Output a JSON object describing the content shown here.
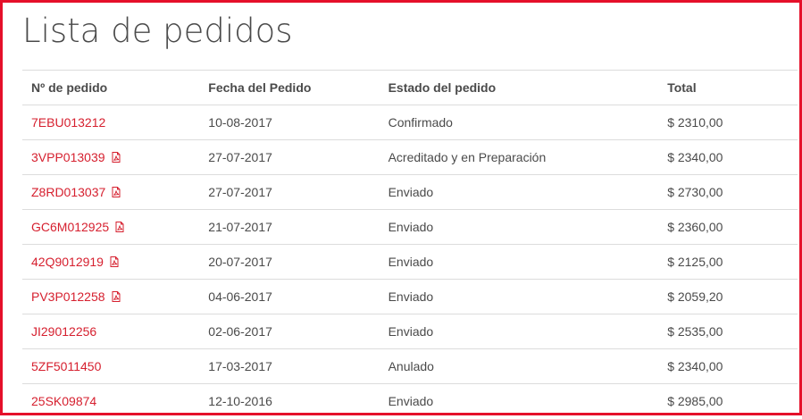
{
  "page": {
    "title": "Lista de pedidos"
  },
  "table": {
    "headers": [
      "Nº de pedido",
      "Fecha del Pedido",
      "Estado del pedido",
      "Total"
    ],
    "rows": [
      {
        "order": "7EBU013212",
        "date": "10-08-2017",
        "status": "Confirmado",
        "total": "$ 2310,00",
        "pdf": false
      },
      {
        "order": "3VPP013039",
        "date": "27-07-2017",
        "status": "Acreditado y en Preparación",
        "total": "$ 2340,00",
        "pdf": true
      },
      {
        "order": "Z8RD013037",
        "date": "27-07-2017",
        "status": "Enviado",
        "total": "$ 2730,00",
        "pdf": true
      },
      {
        "order": "GC6M012925",
        "date": "21-07-2017",
        "status": "Enviado",
        "total": "$ 2360,00",
        "pdf": true
      },
      {
        "order": "42Q9012919",
        "date": "20-07-2017",
        "status": "Enviado",
        "total": "$ 2125,00",
        "pdf": true
      },
      {
        "order": "PV3P012258",
        "date": "04-06-2017",
        "status": "Enviado",
        "total": "$ 2059,20",
        "pdf": true
      },
      {
        "order": "JI29012256",
        "date": "02-06-2017",
        "status": "Enviado",
        "total": "$ 2535,00",
        "pdf": false
      },
      {
        "order": "5ZF5011450",
        "date": "17-03-2017",
        "status": "Anulado",
        "total": "$ 2340,00",
        "pdf": false
      },
      {
        "order": "25SK09874",
        "date": "12-10-2016",
        "status": "Enviado",
        "total": "$ 2985,00",
        "pdf": false
      }
    ]
  },
  "colors": {
    "accent": "#d6202f",
    "frame": "#e5102a",
    "text": "#4a4a4a",
    "divider": "#dcdcdc"
  },
  "icons": {
    "pdf": "pdf-icon"
  }
}
